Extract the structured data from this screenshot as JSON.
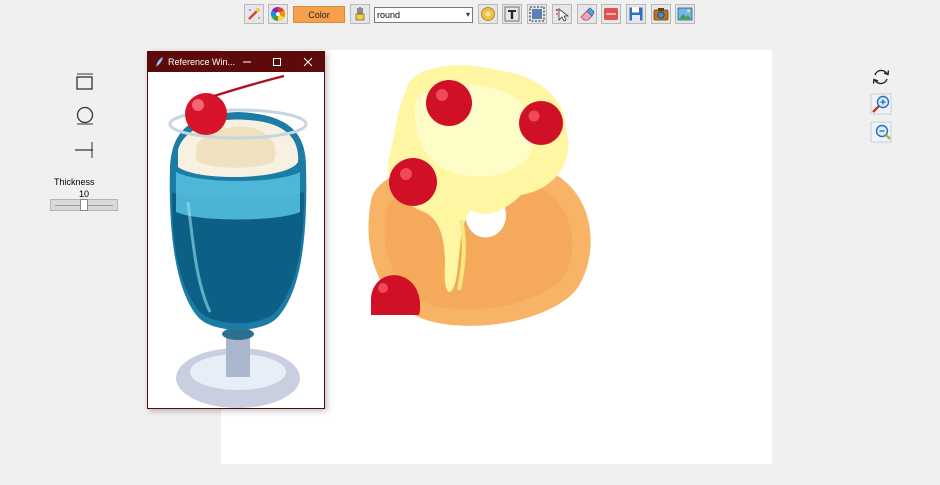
{
  "toolbar": {
    "color_button": "Color",
    "brush_select": {
      "value": "round"
    },
    "icons": [
      "magic-pen-icon",
      "color-wheel-icon",
      "brush-fill-icon",
      "stamp-icon",
      "text-icon",
      "select-region-icon",
      "cursor-icon",
      "eraser-icon",
      "clear-icon",
      "save-icon",
      "camera-icon",
      "image-icon"
    ],
    "colors": {
      "color_button": "#f7a04b",
      "clear_button": "#e0524f"
    }
  },
  "left_tools": {
    "icons": [
      "rectangle-tool-icon",
      "circle-tool-icon",
      "line-tool-icon"
    ],
    "thickness_label": "Thickness",
    "thickness_value": "10",
    "thickness_level": 0.5
  },
  "right_tools": {
    "icons": [
      "refresh-icon",
      "zoom-in-icon",
      "zoom-out-icon"
    ]
  },
  "reference_window": {
    "title": "Reference Win...",
    "titlebar_color": "#5c0a0a",
    "image_subject": "blue cream soda float with cherry"
  },
  "canvas": {
    "background": "#ffffff",
    "drawing_subject": "donut topped with cream and cherries"
  }
}
